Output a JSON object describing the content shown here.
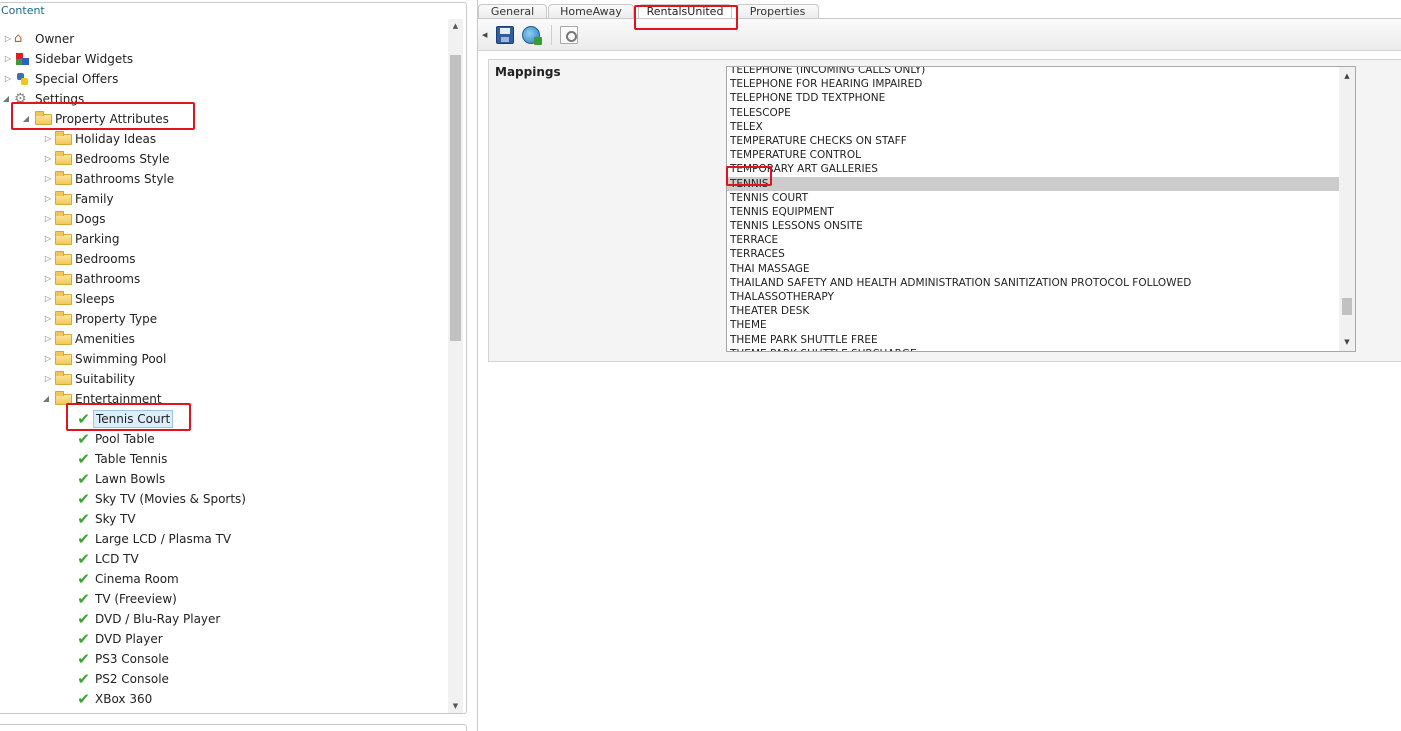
{
  "left_panel": {
    "header": "Content",
    "tree": [
      {
        "label": "Owner",
        "icon": "home-icon"
      },
      {
        "label": "Sidebar Widgets",
        "icon": "widgets-icon"
      },
      {
        "label": "Special Offers",
        "icon": "python-icon"
      },
      {
        "label": "Settings",
        "icon": "gear-icon"
      },
      {
        "label": "Property Attributes",
        "icon": "folder-icon"
      },
      {
        "label": "Holiday Ideas",
        "icon": "folder-icon"
      },
      {
        "label": "Bedrooms Style",
        "icon": "folder-icon"
      },
      {
        "label": "Bathrooms Style",
        "icon": "folder-icon"
      },
      {
        "label": "Family",
        "icon": "folder-icon"
      },
      {
        "label": "Dogs",
        "icon": "folder-icon"
      },
      {
        "label": "Parking",
        "icon": "folder-icon"
      },
      {
        "label": "Bedrooms",
        "icon": "folder-icon"
      },
      {
        "label": "Bathrooms",
        "icon": "folder-icon"
      },
      {
        "label": "Sleeps",
        "icon": "folder-icon"
      },
      {
        "label": "Property Type",
        "icon": "folder-icon"
      },
      {
        "label": "Amenities",
        "icon": "folder-icon"
      },
      {
        "label": "Swimming Pool",
        "icon": "folder-icon"
      },
      {
        "label": "Suitability",
        "icon": "folder-icon"
      },
      {
        "label": "Entertainment",
        "icon": "folder-icon"
      },
      {
        "label": "Tennis Court",
        "icon": "check-icon"
      },
      {
        "label": "Pool Table",
        "icon": "check-icon"
      },
      {
        "label": "Table Tennis",
        "icon": "check-icon"
      },
      {
        "label": "Lawn Bowls",
        "icon": "check-icon"
      },
      {
        "label": "Sky TV (Movies & Sports)",
        "icon": "check-icon"
      },
      {
        "label": "Sky TV",
        "icon": "check-icon"
      },
      {
        "label": "Large LCD / Plasma TV",
        "icon": "check-icon"
      },
      {
        "label": "LCD TV",
        "icon": "check-icon"
      },
      {
        "label": "Cinema Room",
        "icon": "check-icon"
      },
      {
        "label": "TV (Freeview)",
        "icon": "check-icon"
      },
      {
        "label": "DVD / Blu-Ray Player",
        "icon": "check-icon"
      },
      {
        "label": "DVD Player",
        "icon": "check-icon"
      },
      {
        "label": "PS3 Console",
        "icon": "check-icon"
      },
      {
        "label": "PS2 Console",
        "icon": "check-icon"
      },
      {
        "label": "XBox 360",
        "icon": "check-icon"
      }
    ]
  },
  "right_panel": {
    "tabs": [
      "General",
      "HomeAway",
      "RentalsUnited",
      "Properties"
    ],
    "active_tab": "RentalsUnited",
    "toolbar": {
      "save": "save-icon",
      "refresh": "refresh-icon",
      "preview": "preview-icon"
    },
    "mappings_label": "Mappings",
    "mappings_options": [
      "TELEPHONE (INCOMING CALLS ONLY)",
      "TELEPHONE FOR HEARING IMPAIRED",
      "TELEPHONE TDD TEXTPHONE",
      "TELESCOPE",
      "TELEX",
      "TEMPERATURE CHECKS ON STAFF",
      "TEMPERATURE CONTROL",
      "TEMPORARY ART GALLERIES",
      "TENNIS",
      "TENNIS COURT",
      "TENNIS EQUIPMENT",
      "TENNIS LESSONS ONSITE",
      "TERRACE",
      "TERRACES",
      "THAI MASSAGE",
      "THAILAND SAFETY AND HEALTH ADMINISTRATION SANITIZATION PROTOCOL FOLLOWED",
      "THALASSOTHERAPY",
      "THEATER DESK",
      "THEME",
      "THEME PARK SHUTTLE FREE",
      "THEME PARK SHUTTLE SURCHARGE"
    ],
    "selected_option": "TENNIS"
  },
  "colors": {
    "annotation": "#e0141e",
    "selected_row": "#cccccc",
    "check": "#3aa535",
    "folder": "#f3c65b"
  }
}
